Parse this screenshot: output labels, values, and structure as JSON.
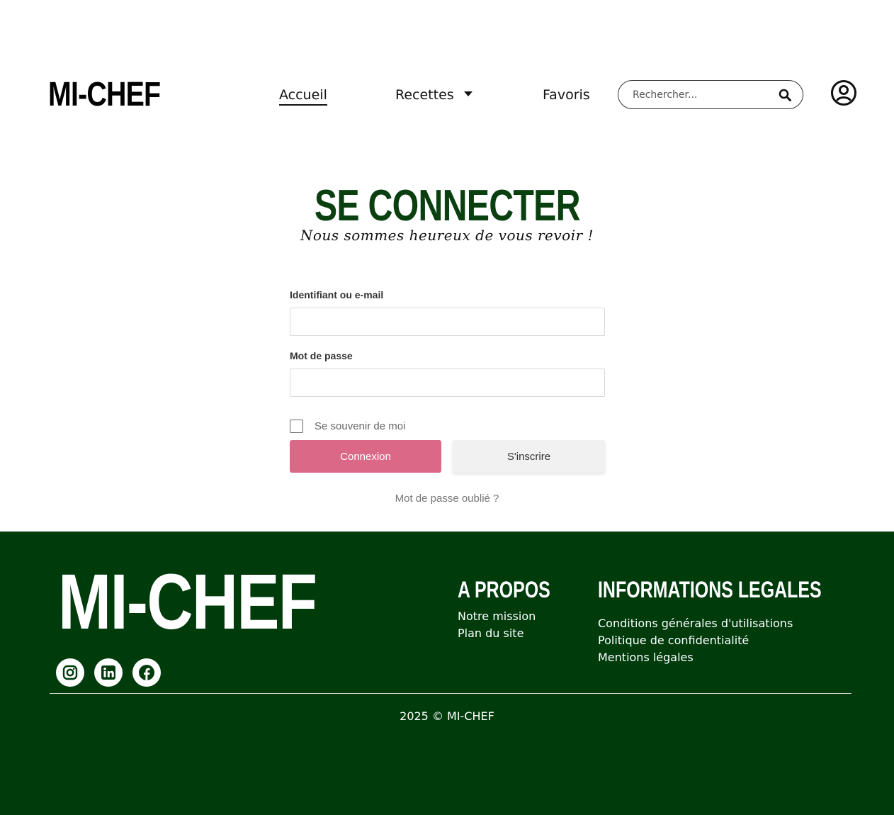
{
  "header": {
    "logo": "MI-CHEF",
    "nav": {
      "accueil": "Accueil",
      "recettes": "Recettes",
      "favoris": "Favoris"
    },
    "search": {
      "placeholder": "Rechercher..."
    }
  },
  "login": {
    "title": "SE CONNECTER",
    "subtitle": "Nous sommes heureux de vous revoir !",
    "identifier_label": "Identifiant ou e-mail",
    "identifier_value": "",
    "password_label": "Mot de passe",
    "password_value": "",
    "remember_label": "Se souvenir de moi",
    "remember_checked": false,
    "login_button": "Connexion",
    "register_button": "S'inscrire",
    "forgot_link": "Mot de passe oublié ?"
  },
  "footer": {
    "logo": "MI-CHEF",
    "social": [
      "instagram-icon",
      "linkedin-icon",
      "facebook-icon"
    ],
    "about": {
      "heading": "A PROPOS",
      "links": [
        "Notre mission",
        "Plan du site"
      ]
    },
    "legal": {
      "heading": "INFORMATIONS LEGALES",
      "links": [
        "Conditions générales d'utilisations",
        "Politique de confidentialité",
        "Mentions légales"
      ]
    },
    "copyright": "2025 © MI-CHEF"
  },
  "colors": {
    "brand_green": "#003b0c",
    "title_green": "#0a4010",
    "login_pink": "#dc6888"
  }
}
